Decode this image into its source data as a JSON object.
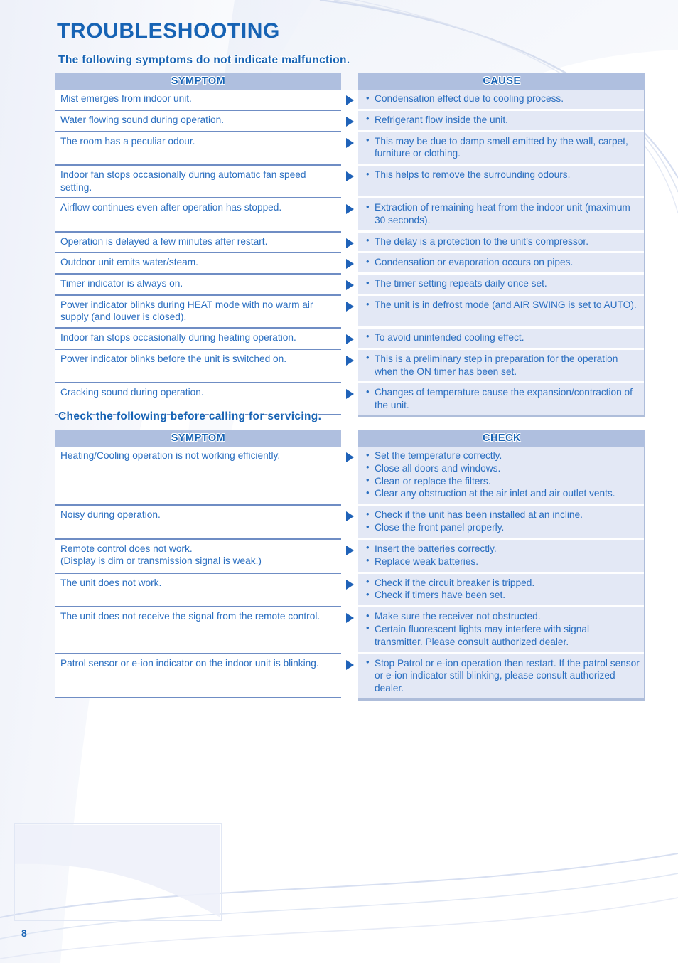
{
  "page": {
    "title": "TROUBLESHOOTING",
    "number": "8",
    "accent_color": "#1763b4",
    "text_color": "#2a6ec0",
    "header_bar_color": "#afbfdf",
    "check_cell_color": "#e3e8f5",
    "rule_color": "#6f8dc4"
  },
  "section1": {
    "heading": "The following symptoms do not indicate malfunction.",
    "columns": [
      "SYMPTOM",
      "CAUSE"
    ],
    "arrow_icon": "triangle-right-icon",
    "rows": [
      {
        "symptom": "Mist emerges from indoor unit.",
        "cause": [
          "Condensation effect due to cooling process."
        ]
      },
      {
        "symptom": "Water flowing sound during operation.",
        "cause": [
          "Refrigerant flow inside the unit."
        ]
      },
      {
        "symptom": "The room has a peculiar odour.",
        "cause": [
          "This may be due to damp smell emitted by the wall, carpet, furniture or clothing."
        ]
      },
      {
        "symptom": "Indoor fan stops occasionally during automatic fan speed setting.",
        "cause": [
          "This helps to remove the surrounding odours."
        ]
      },
      {
        "symptom": "Airflow continues even after operation has stopped.",
        "cause": [
          "Extraction of remaining heat from the indoor unit (maximum 30 seconds)."
        ]
      },
      {
        "symptom": "Operation is delayed a few minutes after restart.",
        "cause": [
          "The delay is a protection to the unit’s compressor."
        ]
      },
      {
        "symptom": "Outdoor unit emits water/steam.",
        "cause": [
          "Condensation or evaporation occurs on pipes."
        ]
      },
      {
        "symptom": "Timer indicator is always on.",
        "cause": [
          "The timer setting repeats daily once set."
        ]
      },
      {
        "symptom": "Power indicator blinks during HEAT mode with no warm air supply (and louver is closed).",
        "cause": [
          "The unit is in defrost mode (and AIR SWING is set to AUTO)."
        ]
      },
      {
        "symptom": "Indoor fan stops occasionally during heating operation.",
        "cause": [
          "To avoid unintended cooling effect."
        ]
      },
      {
        "symptom": "Power indicator blinks before the unit is switched on.",
        "cause": [
          "This is a preliminary step in preparation for the operation when the ON timer has been set."
        ]
      },
      {
        "symptom": "Cracking sound during operation.",
        "cause": [
          "Changes of temperature cause the expansion/contraction of the unit."
        ]
      }
    ]
  },
  "section2": {
    "heading": "Check the following before calling for servicing.",
    "columns": [
      "SYMPTOM",
      "CHECK"
    ],
    "arrow_icon": "triangle-right-icon",
    "rows": [
      {
        "symptom": "Heating/Cooling operation is not working efficiently.",
        "check": [
          "Set the temperature correctly.",
          "Close all doors and windows.",
          "Clean or replace the filters.",
          "Clear any obstruction at the air inlet and air outlet vents."
        ]
      },
      {
        "symptom": "Noisy during operation.",
        "check": [
          "Check if the unit has been installed at an incline.",
          "Close the front panel properly."
        ]
      },
      {
        "symptom": "Remote control does not work.\n(Display is dim or transmission signal is weak.)",
        "check": [
          "Insert the batteries correctly.",
          "Replace weak batteries."
        ]
      },
      {
        "symptom": "The unit does not work.",
        "check": [
          "Check if the circuit breaker is tripped.",
          "Check if timers have been set."
        ]
      },
      {
        "symptom": "The unit does not receive the signal from the remote control.",
        "check": [
          "Make sure the receiver not obstructed.",
          "Certain fluorescent lights may interfere with signal transmitter. Please consult authorized dealer."
        ]
      },
      {
        "symptom": "Patrol sensor or e-ion indicator on the indoor unit is blinking.",
        "check": [
          "Stop Patrol or e-ion operation then restart. If the patrol sensor or e-ion indicator still blinking, please consult authorized dealer."
        ]
      }
    ]
  }
}
